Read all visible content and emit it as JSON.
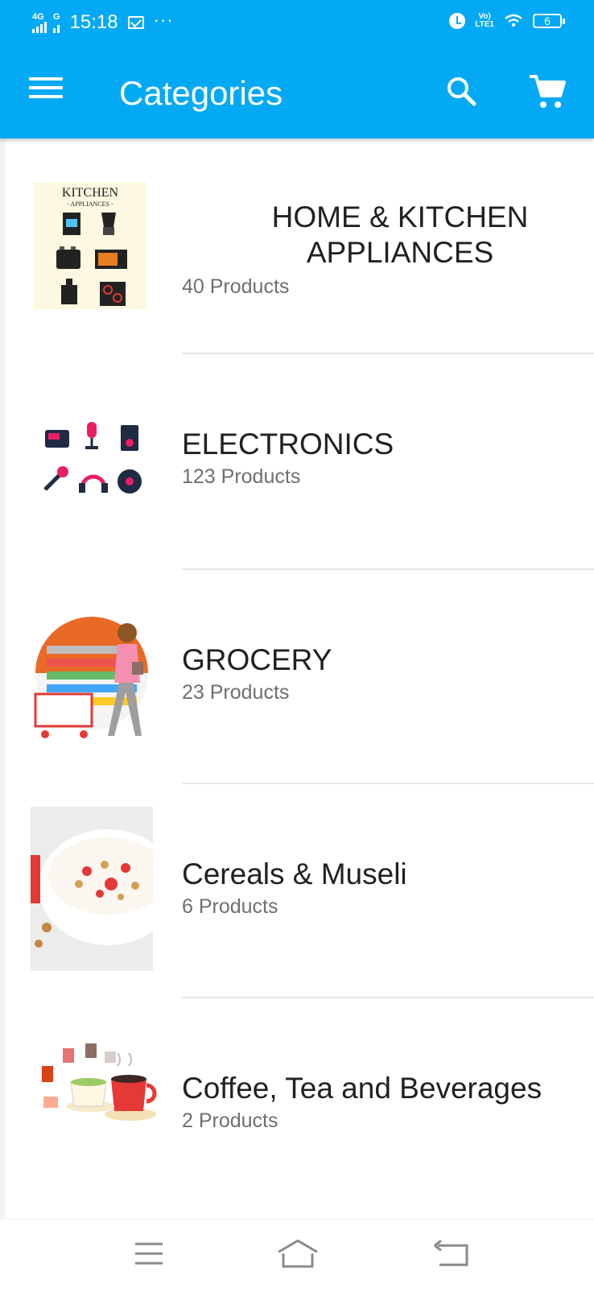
{
  "status_bar": {
    "network_label": "4G",
    "network2_label": "G",
    "time": "15:18",
    "dots": "···",
    "volte_label": "Vo)",
    "lte_label": "LTE1",
    "battery_level": "6"
  },
  "app_bar": {
    "title": "Categories",
    "menu_icon": "hamburger-menu-icon",
    "search_icon": "search-icon",
    "cart_icon": "shopping-cart-icon",
    "color": "#03A9F4"
  },
  "categories": [
    {
      "name": "HOME & KITCHEN APPLIANCES",
      "count": "40 Products",
      "image_title": "KITCHEN",
      "image_subtitle": "- APPLIANCES -"
    },
    {
      "name": "ELECTRONICS",
      "count": "123 Products"
    },
    {
      "name": "GROCERY",
      "count": "23 Products"
    },
    {
      "name": "Cereals & Museli",
      "count": "6 Products"
    },
    {
      "name": "Coffee, Tea and Beverages",
      "count": "2 Products"
    }
  ],
  "nav_bar": {
    "menu_icon": "nav-menu-icon",
    "home_icon": "nav-home-icon",
    "back_icon": "nav-back-icon"
  }
}
